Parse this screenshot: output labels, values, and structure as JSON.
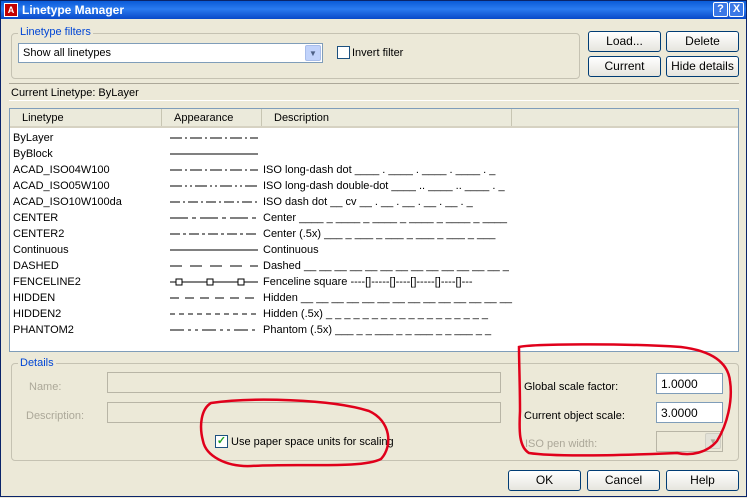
{
  "window": {
    "title": "Linetype Manager",
    "help_glyph": "?",
    "close_glyph": "X"
  },
  "filters": {
    "group_label": "Linetype filters",
    "combo_value": "Show all linetypes",
    "invert_label": "Invert filter"
  },
  "buttons": {
    "load": "Load...",
    "delete": "Delete",
    "current": "Current",
    "hide_details": "Hide details",
    "ok": "OK",
    "cancel": "Cancel",
    "help": "Help"
  },
  "current_linetype": "Current Linetype:  ByLayer",
  "list": {
    "headers": [
      "Linetype",
      "Appearance",
      "Description"
    ],
    "rows": [
      {
        "name": "ByLayer",
        "pattern": "dashdot",
        "desc": ""
      },
      {
        "name": "ByBlock",
        "pattern": "solid",
        "desc": ""
      },
      {
        "name": "ACAD_ISO04W100",
        "pattern": "dashdot",
        "desc": "ISO long-dash dot ____ . ____ . ____ . ____ . _"
      },
      {
        "name": "ACAD_ISO05W100",
        "pattern": "dashdotdot",
        "desc": "ISO long-dash double-dot ____ .. ____ .. ____ . _"
      },
      {
        "name": "ACAD_ISO10W100da",
        "pattern": "dashdot2",
        "desc": "ISO dash dot __ cv __ . __ . __ . __ . __ . _"
      },
      {
        "name": "CENTER",
        "pattern": "center",
        "desc": "Center ____ _ ____ _ ____ _ ____ _ ____ _ ____"
      },
      {
        "name": "CENTER2",
        "pattern": "center2",
        "desc": "Center (.5x) ___ _ ___ _ ___ _ ___ _ ___ _ ___"
      },
      {
        "name": "Continuous",
        "pattern": "solid",
        "desc": "Continuous"
      },
      {
        "name": "DASHED",
        "pattern": "dashed",
        "desc": "Dashed __ __ __ __ __ __ __ __ __ __ __ __ __ _"
      },
      {
        "name": "FENCELINE2",
        "pattern": "fence",
        "desc": "Fenceline square ----[]-----[]----[]-----[]----[]---"
      },
      {
        "name": "HIDDEN",
        "pattern": "hidden",
        "desc": "Hidden __ __ __ __ __ __ __ __ __ __ __ __ __ __"
      },
      {
        "name": "HIDDEN2",
        "pattern": "hidden2",
        "desc": "Hidden (.5x) _ _ _ _ _ _ _ _ _ _ _ _ _ _ _ _ _ _"
      },
      {
        "name": "PHANTOM2",
        "pattern": "phantom",
        "desc": "Phantom (.5x) ___ _ _ ___ _ _ ___ _ _ ___ _ _"
      }
    ]
  },
  "details": {
    "group_label": "Details",
    "name_label": "Name:",
    "description_label": "Description:",
    "paper_space_label": "Use paper space units for scaling",
    "global_scale_label": "Global scale factor:",
    "global_scale_value": "1.0000",
    "object_scale_label": "Current object scale:",
    "object_scale_value": "3.0000",
    "iso_pen_label": "ISO pen width:",
    "check_glyph": "✓"
  },
  "colors": {
    "annotation": "#e0001b",
    "accent": "#0046d5"
  }
}
